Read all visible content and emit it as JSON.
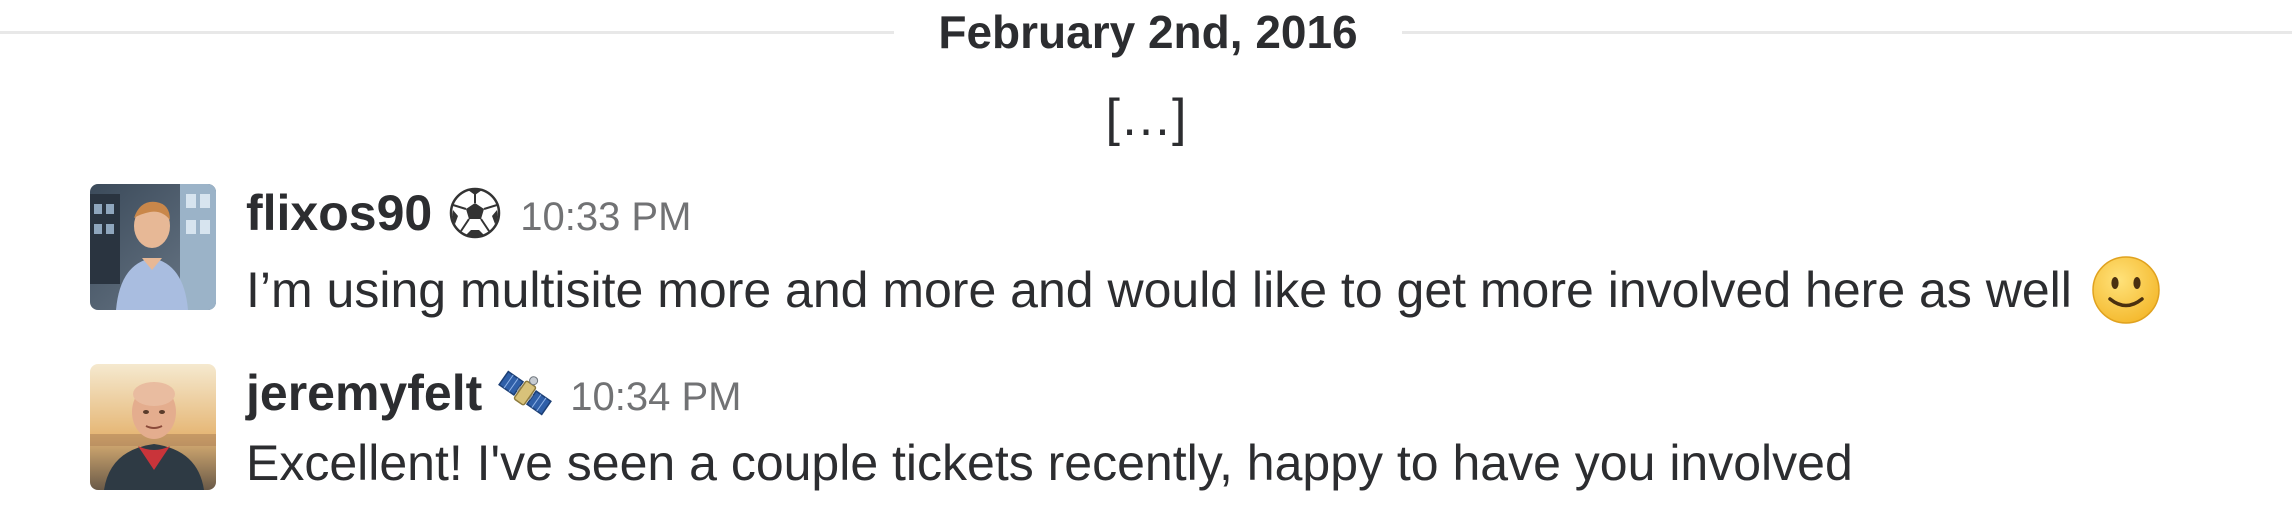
{
  "day_divider": {
    "label": "February 2nd, 2016"
  },
  "omitted_marker": "[…]",
  "messages": [
    {
      "username": "flixos90",
      "status_emoji": "soccer-ball-icon",
      "timestamp": "10:33 PM",
      "text": "I’m using multisite more and more and would like to get more involved here as well",
      "inline_emoji": "slightly-smiling-face-icon"
    },
    {
      "username": "jeremyfelt",
      "status_emoji": "satellite-icon",
      "timestamp": "10:34 PM",
      "text": "Excellent! I've seen a couple tickets recently, happy to have you involved"
    }
  ],
  "colors": {
    "text": "#2c2d30",
    "timestamp": "#717274",
    "divider": "#e8e8e8",
    "emoji_yellow": "#f7c33c"
  }
}
